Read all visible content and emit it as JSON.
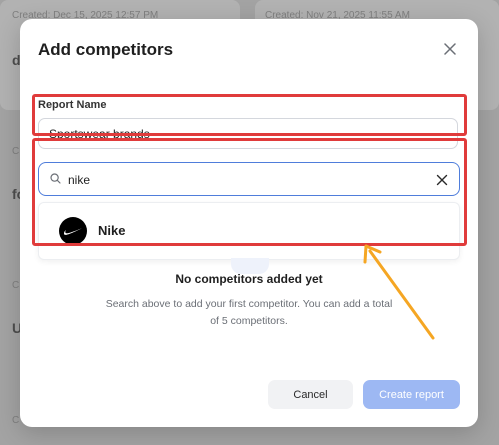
{
  "background": {
    "cards": [
      {
        "created": "Created: Dec 15, 2025 12:57 PM",
        "initial": "d"
      },
      {
        "created": "Created: Nov 21, 2025 11:55 AM",
        "initial": ""
      }
    ],
    "side_initials": [
      "fo",
      "U"
    ],
    "side_fragments": [
      "C",
      "C",
      "C"
    ]
  },
  "modal": {
    "title": "Add competitors",
    "report_name_label": "Report Name",
    "report_name_value": "Sportswear brands",
    "search_value": "nike",
    "results": [
      {
        "name": "Nike",
        "logo_icon": "nike-swoosh-icon"
      }
    ],
    "empty_title": "No competitors added yet",
    "empty_description": "Search above to add your first competitor. You can add a total of 5 competitors.",
    "cancel_label": "Cancel",
    "create_label": "Create report"
  },
  "colors": {
    "highlight": "#e03b3b",
    "arrow": "#f5a623",
    "accent": "#4f7ddb",
    "create_disabled": "#9db8f3"
  }
}
